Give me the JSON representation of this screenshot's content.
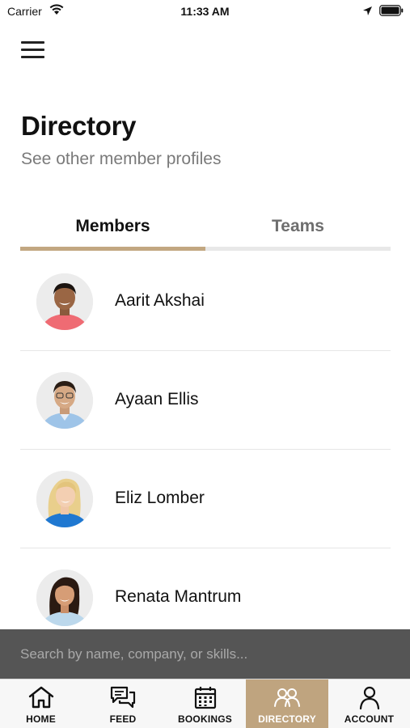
{
  "status_bar": {
    "carrier": "Carrier",
    "time": "11:33 AM",
    "icons": [
      "wifi-icon",
      "location-icon",
      "battery-icon"
    ]
  },
  "header": {
    "menu_icon": "menu-icon",
    "title": "Directory",
    "subtitle": "See other member profiles"
  },
  "tabs": [
    {
      "label": "Members",
      "active": true
    },
    {
      "label": "Teams",
      "active": false
    }
  ],
  "members": [
    {
      "name": "Aarit Akshai"
    },
    {
      "name": "Ayaan Ellis"
    },
    {
      "name": "Eliz Lomber"
    },
    {
      "name": "Renata Mantrum"
    }
  ],
  "search": {
    "placeholder": "Search by name, company, or skills...",
    "value": ""
  },
  "tab_bar": [
    {
      "label": "HOME",
      "icon": "home-icon",
      "active": false
    },
    {
      "label": "FEED",
      "icon": "feed-icon",
      "active": false
    },
    {
      "label": "BOOKINGS",
      "icon": "calendar-icon",
      "active": false
    },
    {
      "label": "DIRECTORY",
      "icon": "people-icon",
      "active": true
    },
    {
      "label": "ACCOUNT",
      "icon": "person-icon",
      "active": false
    }
  ],
  "colors": {
    "accent": "#c2a781",
    "tab_bar_active": "#bfa47f",
    "search_bar_bg": "#555555"
  }
}
